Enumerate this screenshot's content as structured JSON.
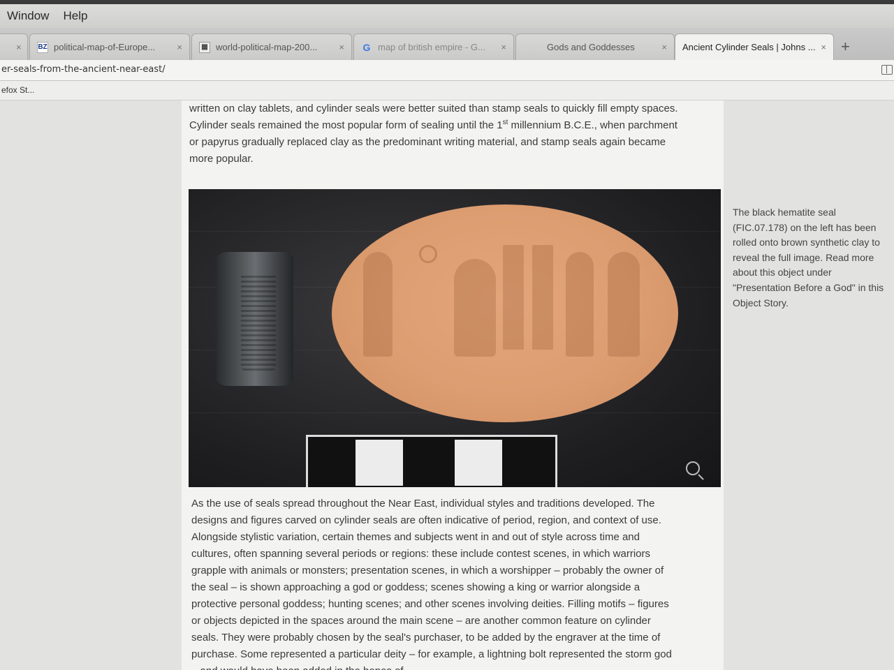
{
  "menubar": {
    "items": [
      "Window",
      "Help"
    ]
  },
  "tabs": [
    {
      "title": "political-map-of-Europe...",
      "favicon": "bz-favicon",
      "active": false
    },
    {
      "title": "world-political-map-200...",
      "favicon": "world-map-favicon",
      "active": false
    },
    {
      "title": "map of british empire - G...",
      "favicon": "google-favicon",
      "active": false
    },
    {
      "title": "Gods and Goddesses",
      "favicon": "",
      "active": false
    },
    {
      "title": "Ancient Cylinder Seals | Johns ...",
      "favicon": "",
      "active": true
    }
  ],
  "newtab_label": "+",
  "close_glyph": "×",
  "url": "er-seals-from-the-ancient-near-east/",
  "bookmarks": [
    {
      "label": "efox St..."
    }
  ],
  "article": {
    "para1_a": "written on clay tablets, and cylinder seals were better suited than stamp seals to quickly fill empty spaces.  Cylinder seals remained the most popular form of sealing until the 1",
    "para1_sup": "st",
    "para1_b": " millennium B.C.E., when parchment or papyrus gradually replaced clay as the predominant writing material, and stamp seals again became more popular.",
    "para2": "As the use of seals spread throughout the Near East, individual styles and traditions developed. The designs and figures carved on cylinder seals are often indicative of period, region, and context of use.  Alongside stylistic variation, certain themes and subjects went in and out of style across time and cultures, often spanning several periods or regions:  these include contest scenes, in which warriors grapple with animals or monsters; presentation scenes, in which a worshipper – probably the owner of the seal – is shown approaching a god or goddess; scenes showing a king or warrior alongside a protective personal goddess; hunting scenes; and other scenes involving deities.  Filling motifs – figures or objects depicted in the spaces around the main scene – are another common feature on cylinder seals.  They were probably chosen by the seal's purchaser, to be added by the engraver at the time of purchase.  Some represented a particular deity – for example, a lightning bolt represented the storm god – and would have been added in the hopes of"
  },
  "caption": "The black hematite seal (FIC.07.178) on the left has been rolled onto brown synthetic clay to reveal the full image. Read more about this object under \"Presentation Before a God\" in this Object Story."
}
